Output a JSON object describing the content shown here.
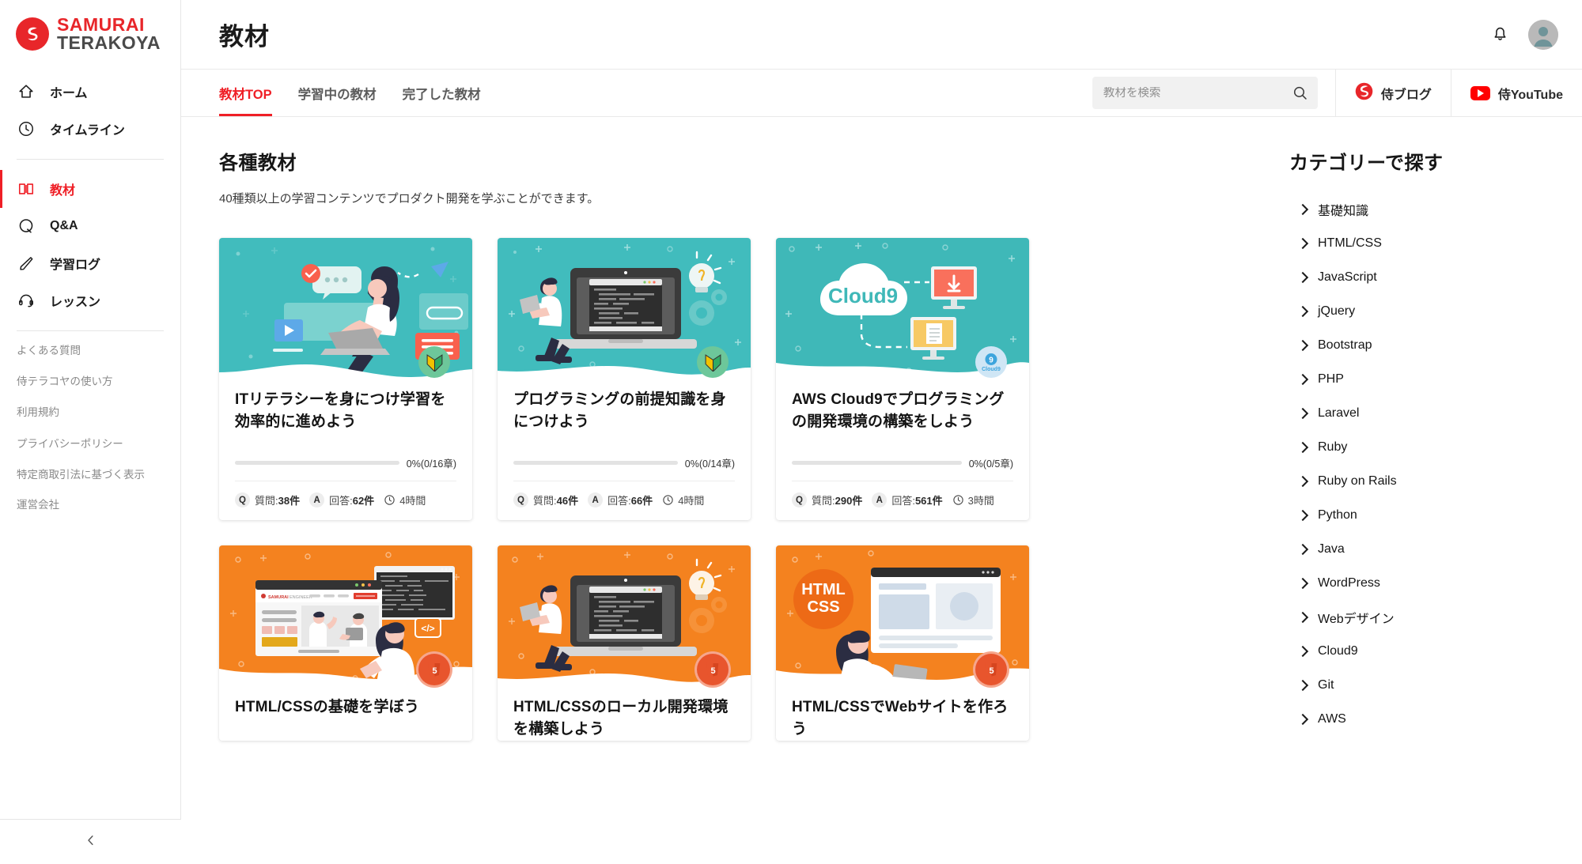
{
  "brand": {
    "line1": "SAMURAI",
    "line2": "TERAKOYA",
    "mark_color": "#e8262a"
  },
  "sidebar": {
    "nav": [
      {
        "label": "ホーム",
        "icon": "home-icon",
        "active": false
      },
      {
        "label": "タイムライン",
        "icon": "clock-icon",
        "active": false
      },
      {
        "label": "教材",
        "icon": "book-icon",
        "active": true
      },
      {
        "label": "Q&A",
        "icon": "question-circle-icon",
        "active": false
      },
      {
        "label": "学習ログ",
        "icon": "pencil-icon",
        "active": false
      },
      {
        "label": "レッスン",
        "icon": "headset-icon",
        "active": false
      }
    ],
    "links": [
      "よくある質問",
      "侍テラコヤの使い方",
      "利用規約",
      "プライバシーポリシー",
      "特定商取引法に基づく表示",
      "運営会社"
    ],
    "collapse_icon": "chevron-left-icon"
  },
  "topbar": {
    "title": "教材",
    "bell_icon": "bell-icon",
    "avatar_icon": "user-avatar"
  },
  "tabs": [
    {
      "label": "教材TOP",
      "active": true
    },
    {
      "label": "学習中の教材",
      "active": false
    },
    {
      "label": "完了した教材",
      "active": false
    }
  ],
  "search": {
    "placeholder": "教材を検索",
    "value": "",
    "icon": "search-icon"
  },
  "external": [
    {
      "label": "侍ブログ",
      "icon": "samurai-logo-icon"
    },
    {
      "label": "侍YouTube",
      "icon": "youtube-icon"
    }
  ],
  "main": {
    "section_title": "各種教材",
    "section_sub": "40種類以上の学習コンテンツでプロダクト開発を学ぶことができます。"
  },
  "cards": [
    {
      "title": "ITリテラシーを身につけ学習を効率的に進めよう",
      "thumb": "illustration-woman-laptop",
      "thumb_color": "#41bcbd",
      "badge": "wakaba-badge",
      "badge_style": "green",
      "progress_pct": 0,
      "progress_label": "0%(0/16章)",
      "q_label": "質問:",
      "q_count": "38件",
      "a_label": "回答:",
      "a_count": "62件",
      "duration": "4時間"
    },
    {
      "title": "プログラミングの前提知識を身につけよう",
      "thumb": "illustration-man-laptop-code",
      "thumb_color": "#41bcbd",
      "badge": "wakaba-badge",
      "badge_style": "green",
      "progress_pct": 0,
      "progress_label": "0%(0/14章)",
      "q_label": "質問:",
      "q_count": "46件",
      "a_label": "回答:",
      "a_count": "66件",
      "duration": "4時間"
    },
    {
      "title": "AWS Cloud9でプログラミングの開発環境の構築をしよう",
      "thumb": "illustration-cloud9",
      "thumb_color": "#3fb8b8",
      "badge": "cloud9-badge",
      "badge_style": "blue",
      "progress_pct": 0,
      "progress_label": "0%(0/5章)",
      "q_label": "質問:",
      "q_count": "290件",
      "a_label": "回答:",
      "a_count": "561件",
      "duration": "3時間"
    },
    {
      "title": "HTML/CSSの基礎を学ぼう",
      "thumb": "illustration-html-website",
      "thumb_color": "#f4821f",
      "badge": "html5-badge",
      "badge_style": "html",
      "progress_pct": 0,
      "progress_label": "",
      "q_label": "",
      "q_count": "",
      "a_label": "",
      "a_count": "",
      "duration": ""
    },
    {
      "title": "HTML/CSSのローカル開発環境を構築しよう",
      "thumb": "illustration-man-laptop-code",
      "thumb_color": "#f4821f",
      "badge": "html5-badge",
      "badge_style": "html",
      "progress_pct": 0,
      "progress_label": "",
      "q_label": "",
      "q_count": "",
      "a_label": "",
      "a_count": "",
      "duration": ""
    },
    {
      "title": "HTML/CSSでWebサイトを作ろう",
      "thumb": "illustration-html-css-woman",
      "thumb_color": "#f4821f",
      "badge": "html5-badge",
      "badge_style": "html",
      "progress_pct": 0,
      "progress_label": "",
      "q_label": "",
      "q_count": "",
      "a_label": "",
      "a_count": "",
      "duration": ""
    }
  ],
  "categories": {
    "title": "カテゴリーで探す",
    "items": [
      "基礎知識",
      "HTML/CSS",
      "JavaScript",
      "jQuery",
      "Bootstrap",
      "PHP",
      "Laravel",
      "Ruby",
      "Ruby on Rails",
      "Python",
      "Java",
      "WordPress",
      "Webデザイン",
      "Cloud9",
      "Git",
      "AWS"
    ]
  },
  "colors": {
    "accent_red": "#ef1f26",
    "teal": "#41bcbd",
    "orange": "#f4821f",
    "text": "#1b1b1b",
    "muted": "#8a8a8a"
  }
}
